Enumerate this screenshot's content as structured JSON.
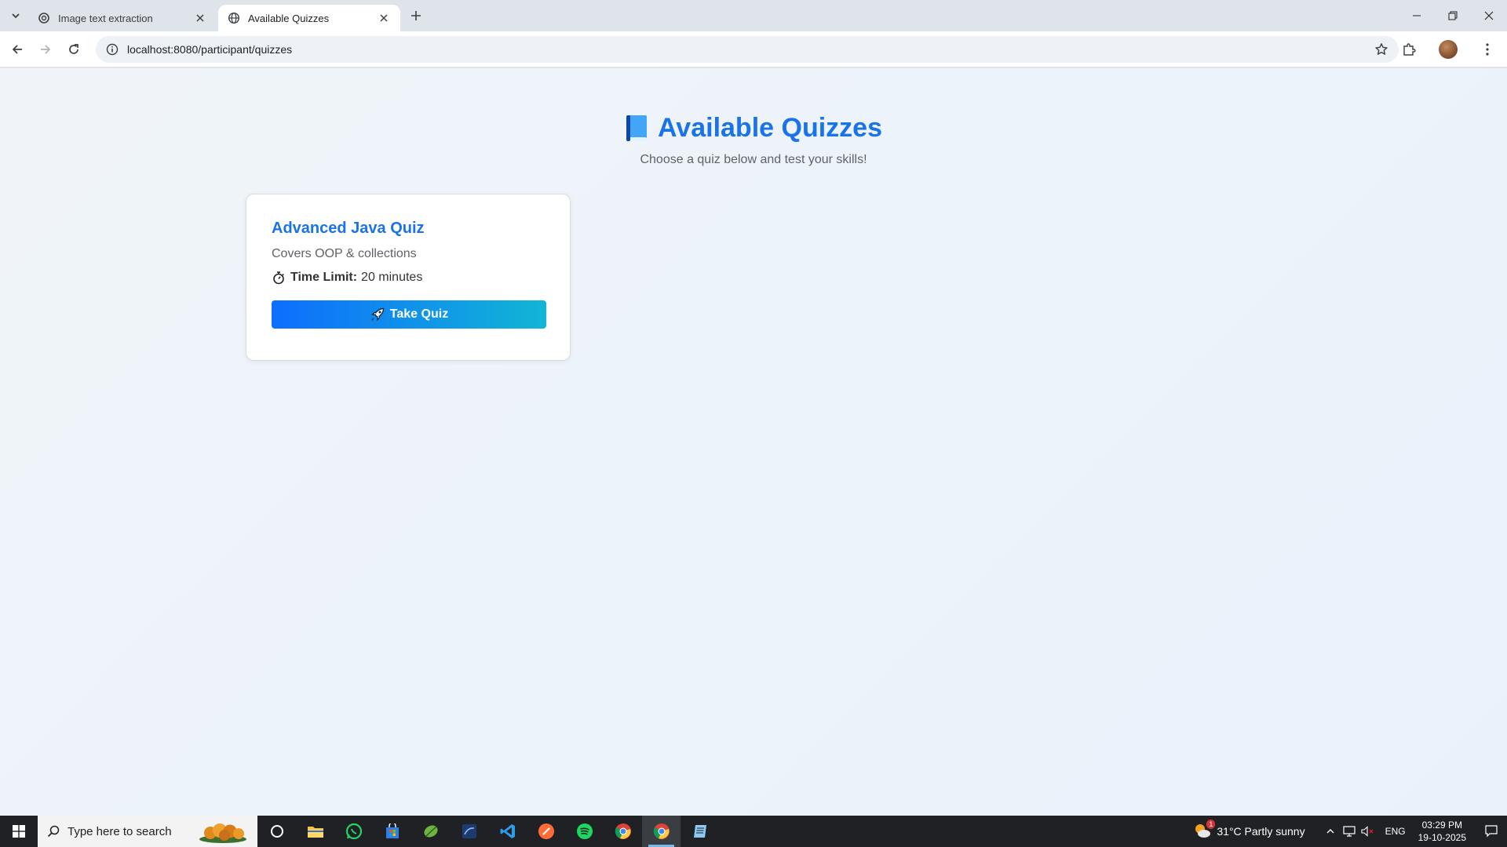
{
  "browser": {
    "tabs": [
      {
        "title": "Image text extraction",
        "active": false
      },
      {
        "title": "Available Quizzes",
        "active": true
      }
    ],
    "url": "localhost:8080/participant/quizzes"
  },
  "page": {
    "title": "Available Quizzes",
    "subtitle": "Choose a quiz below and test your skills!",
    "quizzes": [
      {
        "title": "Advanced Java Quiz",
        "description": "Covers OOP & collections",
        "time_label": "Time Limit:",
        "time_value": "20 minutes",
        "button_label": "Take Quiz"
      }
    ]
  },
  "taskbar": {
    "search_placeholder": "Type here to search",
    "weather": "31°C  Partly sunny",
    "language": "ENG",
    "time": "03:29 PM",
    "date": "19-10-2025",
    "weather_badge": "1"
  },
  "colors": {
    "accent": "#1a73e8",
    "button_start": "#0d6efd",
    "button_end": "#12b5d6",
    "page_bg": "#eef4fa",
    "taskbar_bg": "#1f2125"
  }
}
